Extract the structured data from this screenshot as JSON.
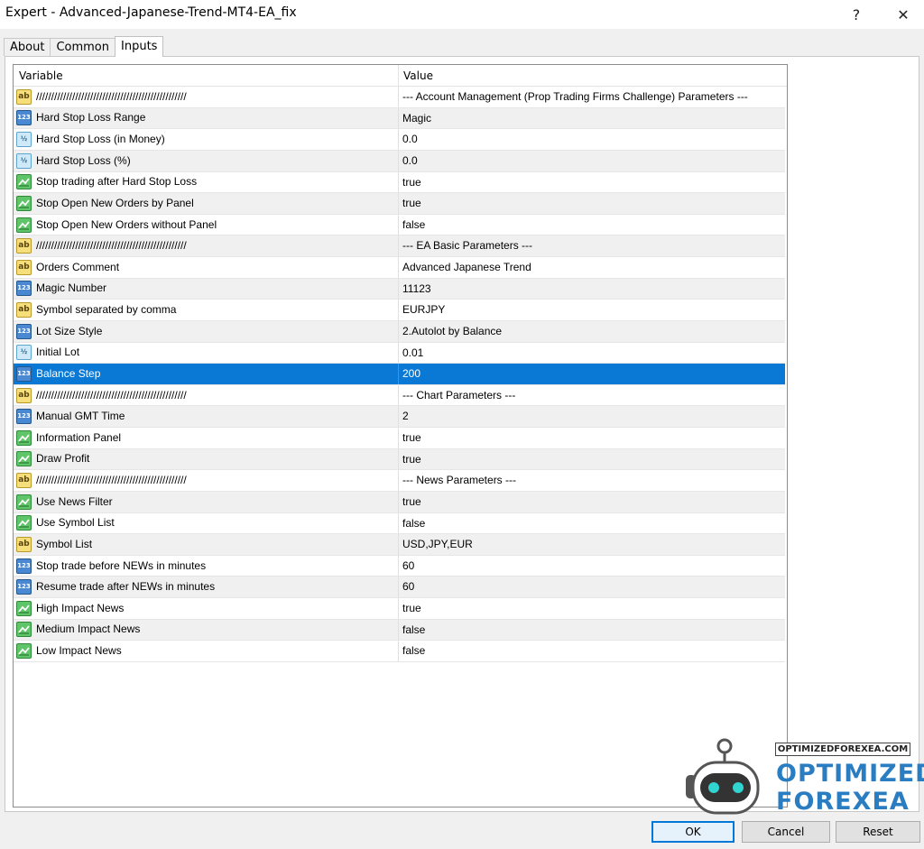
{
  "window": {
    "title": "Expert - Advanced-Japanese-Trend-MT4-EA_fix",
    "help_label": "?",
    "close_label": "✕"
  },
  "tabs": [
    {
      "label": "About",
      "active": false
    },
    {
      "label": "Common",
      "active": false
    },
    {
      "label": "Inputs",
      "active": true
    }
  ],
  "grid": {
    "headers": {
      "variable": "Variable",
      "value": "Value"
    },
    "rows": [
      {
        "type": "string",
        "icon": "string-icon",
        "variable": "//////////////////////////////////////////////////",
        "value": "--- Account Management (Prop Trading Firms Challenge) Parameters ---"
      },
      {
        "type": "int",
        "icon": "integer-icon",
        "variable": "Hard Stop Loss Range",
        "value": "Magic"
      },
      {
        "type": "double",
        "icon": "double-icon",
        "variable": "Hard Stop Loss (in Money)",
        "value": "0.0"
      },
      {
        "type": "double",
        "icon": "double-icon",
        "variable": "Hard Stop Loss (%)",
        "value": "0.0"
      },
      {
        "type": "bool",
        "icon": "boolean-icon",
        "variable": "Stop trading after Hard Stop Loss",
        "value": "true"
      },
      {
        "type": "bool",
        "icon": "boolean-icon",
        "variable": "Stop Open New Orders by Panel",
        "value": "true"
      },
      {
        "type": "bool",
        "icon": "boolean-icon",
        "variable": "Stop Open New Orders without Panel",
        "value": "false"
      },
      {
        "type": "string",
        "icon": "string-icon",
        "variable": "//////////////////////////////////////////////////",
        "value": "--- EA Basic Parameters ---"
      },
      {
        "type": "string",
        "icon": "string-icon",
        "variable": "Orders Comment",
        "value": "Advanced Japanese Trend"
      },
      {
        "type": "int",
        "icon": "integer-icon",
        "variable": "Magic Number",
        "value": "11123"
      },
      {
        "type": "string",
        "icon": "string-icon",
        "variable": "Symbol separated by comma",
        "value": "EURJPY"
      },
      {
        "type": "int",
        "icon": "integer-icon",
        "variable": "Lot Size Style",
        "value": "2.Autolot by Balance"
      },
      {
        "type": "double",
        "icon": "double-icon",
        "variable": "Initial Lot",
        "value": "0.01"
      },
      {
        "type": "int",
        "icon": "integer-icon",
        "variable": "Balance Step",
        "value": "200",
        "selected": true
      },
      {
        "type": "string",
        "icon": "string-icon",
        "variable": "//////////////////////////////////////////////////",
        "value": "--- Chart Parameters ---"
      },
      {
        "type": "int",
        "icon": "integer-icon",
        "variable": "Manual GMT Time",
        "value": "2"
      },
      {
        "type": "bool",
        "icon": "boolean-icon",
        "variable": "Information Panel",
        "value": "true"
      },
      {
        "type": "bool",
        "icon": "boolean-icon",
        "variable": "Draw Profit",
        "value": "true"
      },
      {
        "type": "string",
        "icon": "string-icon",
        "variable": "//////////////////////////////////////////////////",
        "value": "--- News Parameters ---"
      },
      {
        "type": "bool",
        "icon": "boolean-icon",
        "variable": "Use News Filter",
        "value": "true"
      },
      {
        "type": "bool",
        "icon": "boolean-icon",
        "variable": "Use Symbol List",
        "value": "false"
      },
      {
        "type": "string",
        "icon": "string-icon",
        "variable": "Symbol List",
        "value": "USD,JPY,EUR"
      },
      {
        "type": "int",
        "icon": "integer-icon",
        "variable": "Stop trade before NEWs in minutes",
        "value": "60"
      },
      {
        "type": "int",
        "icon": "integer-icon",
        "variable": "Resume trade after NEWs in minutes",
        "value": "60"
      },
      {
        "type": "bool",
        "icon": "boolean-icon",
        "variable": "High Impact News",
        "value": "true"
      },
      {
        "type": "bool",
        "icon": "boolean-icon",
        "variable": "Medium Impact News",
        "value": "false"
      },
      {
        "type": "bool",
        "icon": "boolean-icon",
        "variable": "Low Impact News",
        "value": "false"
      }
    ]
  },
  "buttons": {
    "ok": "OK",
    "cancel": "Cancel",
    "reset": "Reset"
  },
  "watermark": {
    "domain": "OPTIMIZEDFOREXEA.COM",
    "word1": "OPTIMIZED",
    "word2": "FOREXEA"
  },
  "colors": {
    "selection": "#0a79d6",
    "logo_blue": "#2b7dc1",
    "default_button_border": "#0078d7"
  }
}
